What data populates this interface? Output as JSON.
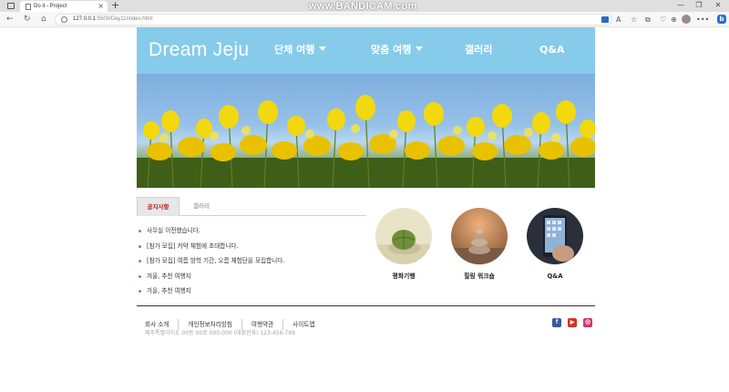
{
  "browser": {
    "tab_title": "Do it - Project",
    "new_tab_icon": "plus",
    "close_icon": "×",
    "url_host": "127.0.0.1",
    "url_rest": ":5500/Day11/index.html",
    "watermark": "www.BANDICAM.com",
    "window_controls": [
      "—",
      "❐",
      "✕"
    ],
    "nav_icons": [
      "←",
      "↻",
      "⌂"
    ],
    "toolbar_icons": [
      "A",
      "☆",
      "⧉",
      "♡",
      "⊕",
      "•••"
    ],
    "bing_label": "b"
  },
  "site": {
    "logo": "Dream Jeju",
    "nav": [
      {
        "label": "단체 여행",
        "dropdown": true
      },
      {
        "label": "맞춤 여행",
        "dropdown": true
      },
      {
        "label": "갤러리",
        "dropdown": false
      },
      {
        "label": "Q&A",
        "dropdown": false
      }
    ],
    "colors": {
      "header": "#86cbe9",
      "active_tab_text": "#b11c1c"
    }
  },
  "notice": {
    "tabs": [
      {
        "label": "공지사항",
        "active": true
      },
      {
        "label": "갤러리",
        "active": false
      }
    ],
    "items": [
      "사무실 이전했습니다.",
      "[참가 모집] 카약 체험에 초대합니다.",
      "[참가 모집] 여름 방학 기간, 오름 체험단을 모집합니다.",
      "겨울, 추천 여행지",
      "가을, 추천 여행지"
    ]
  },
  "features": [
    {
      "label": "평화기행",
      "icon": "leaf-on-stone"
    },
    {
      "label": "힐링 워크숍",
      "icon": "stacked-stones"
    },
    {
      "label": "Q&A",
      "icon": "smartphone"
    }
  ],
  "footer": {
    "links": [
      "회사 소개",
      "개인정보처리방침",
      "여행약관",
      "사이트맵"
    ],
    "address": "제주특별자치도 00동 00로 000-000 (대표전화) 123-456-789",
    "social": [
      {
        "name": "facebook",
        "glyph": "f",
        "color": "#3b5998"
      },
      {
        "name": "youtube",
        "glyph": "▶",
        "color": "#d9302b"
      },
      {
        "name": "instagram",
        "glyph": "◎",
        "color": "#d6336c"
      }
    ]
  }
}
